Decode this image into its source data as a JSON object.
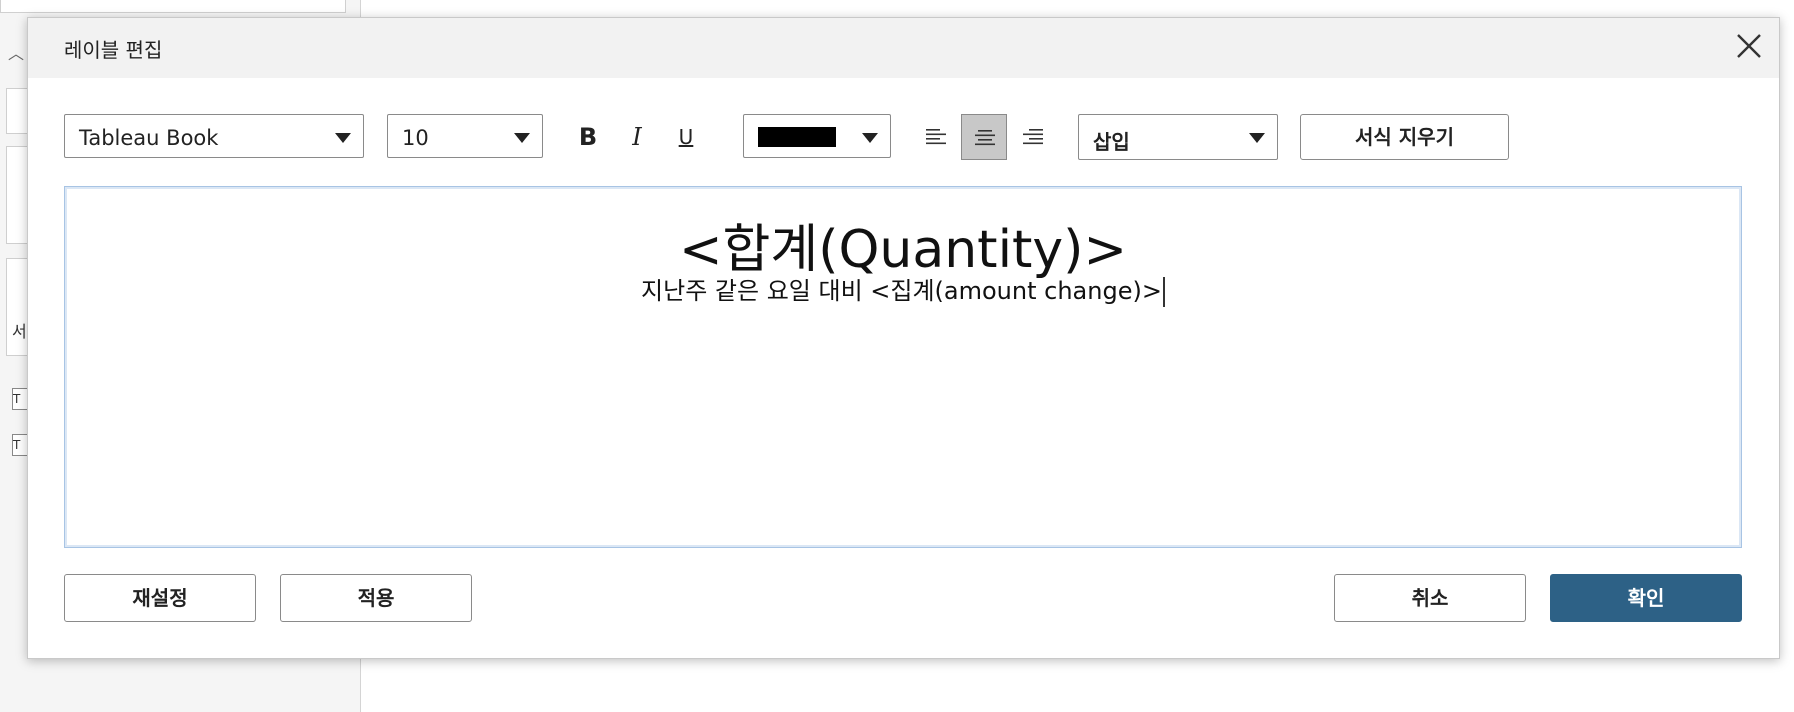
{
  "background": {
    "partial_char": "서"
  },
  "dialog": {
    "title": "레이블 편집",
    "close_icon": "close-icon",
    "toolbar": {
      "font_family": "Tableau Book",
      "font_size": "10",
      "bold_label": "B",
      "italic_label": "I",
      "underline_label": "U",
      "text_color": "#000000",
      "alignment": "center",
      "insert_label": "삽입",
      "clear_format_label": "서식 지우기"
    },
    "editor": {
      "line1": "<합계(Quantity)>",
      "line2": "지난주 같은 요일 대비 <집계(amount change)>"
    },
    "buttons": {
      "reset": "재설정",
      "apply": "적용",
      "cancel": "취소",
      "ok": "확인"
    }
  },
  "colors": {
    "primary_button": "#2d6186",
    "editor_border": "#a8c4e4",
    "active_align_bg": "#c8c8c8"
  }
}
